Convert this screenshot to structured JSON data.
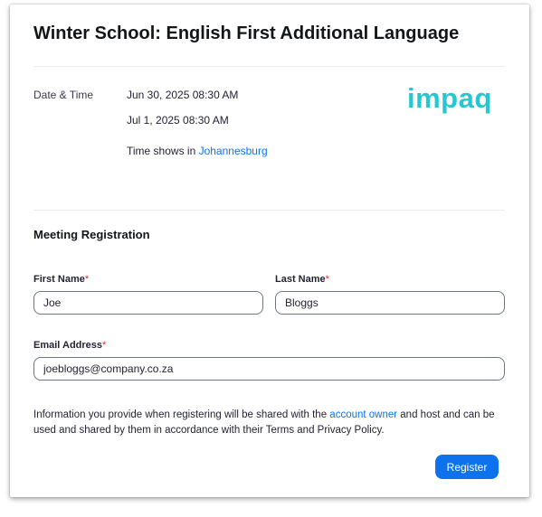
{
  "meeting": {
    "title": "Winter School: English First Additional Language",
    "date_time_label": "Date & Time",
    "occurrences": [
      "Jun 30, 2025 08:30 AM",
      "Jul 1, 2025 08:30 AM"
    ],
    "timezone_prefix": "Time shows in ",
    "timezone_link": "Johannesburg",
    "logo_text": "impaq"
  },
  "registration": {
    "section_title": "Meeting Registration",
    "required_mark": "*",
    "first_name": {
      "label": "First Name",
      "value": "Joe"
    },
    "last_name": {
      "label": "Last Name",
      "value": "Bloggs"
    },
    "email": {
      "label": "Email Address",
      "value": "joebloggs@company.co.za"
    },
    "disclaimer": {
      "before_link": "Information you provide when registering will be shared with the ",
      "link": "account owner",
      "after_link": " and host and can be used and shared by them in accordance with their Terms and Privacy Policy."
    },
    "register_label": "Register"
  },
  "colors": {
    "accent": "#0e72ed",
    "logo": "#27c7cf",
    "required": "#e02828"
  }
}
